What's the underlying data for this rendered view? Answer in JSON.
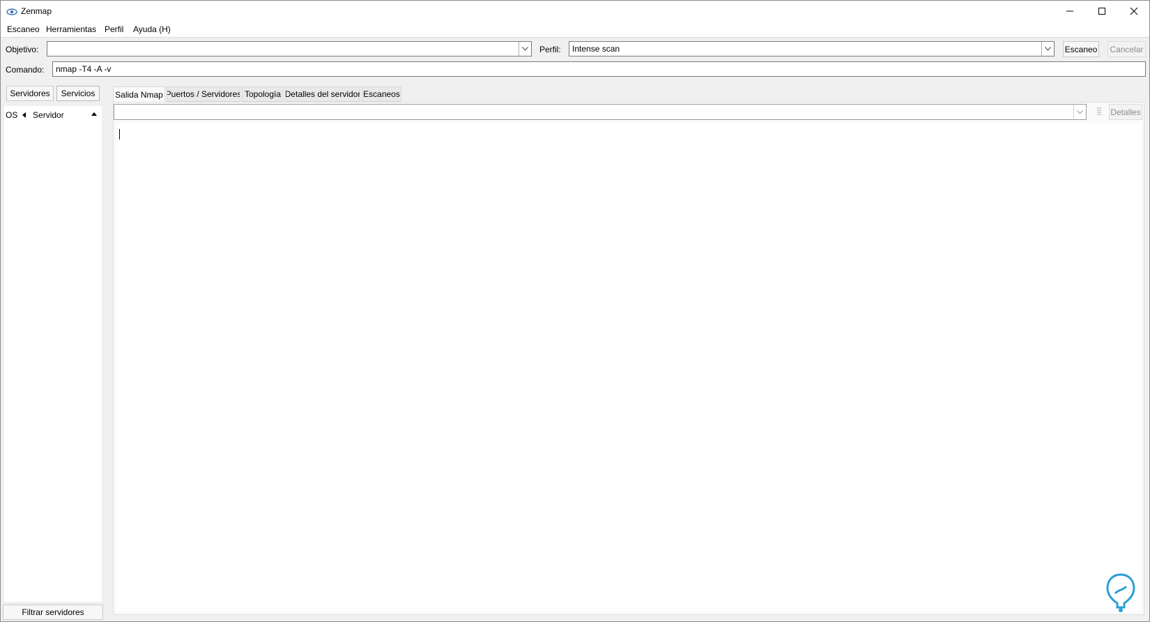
{
  "window": {
    "title": "Zenmap"
  },
  "menu": {
    "items": [
      {
        "label": "Escaneo"
      },
      {
        "label": "Herramientas"
      },
      {
        "label": "Perfil"
      },
      {
        "label": "Ayuda (H)"
      }
    ]
  },
  "toolbar": {
    "target_label": "Objetivo:",
    "target_value": "",
    "profile_label": "Perfil:",
    "profile_value": "Intense scan",
    "scan_button": "Escaneo",
    "cancel_button": "Cancelar",
    "command_label": "Comando:",
    "command_value": "nmap -T4 -A -v"
  },
  "left_pane": {
    "tabs": [
      "Servidores",
      "Servicios"
    ],
    "columns": [
      "OS",
      "Servidor"
    ],
    "filter_button": "Filtrar servidores"
  },
  "right_pane": {
    "tabs": [
      "Salida Nmap",
      "Puertos / Servidores",
      "Topología",
      "Detalles del servidor",
      "Escaneos"
    ],
    "active_tab": "Salida Nmap",
    "scan_select_value": "",
    "details_button": "Detalles",
    "output_text": ""
  },
  "colors": {
    "window_bg": "#f0f0f0",
    "field_border": "#7a7a7a",
    "logo_blue": "#2a9fd6"
  }
}
